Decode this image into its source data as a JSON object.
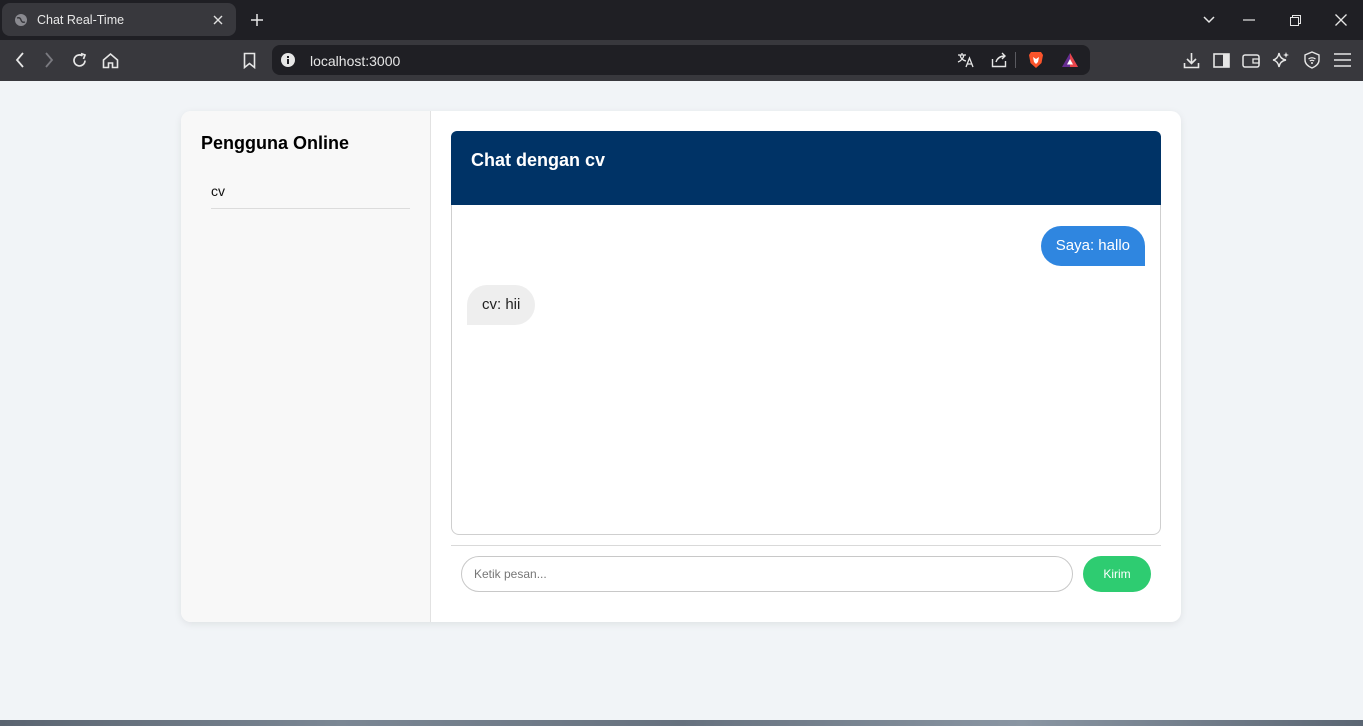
{
  "browser": {
    "tab_title": "Chat Real-Time",
    "url": "localhost:3000"
  },
  "icons": {
    "tab": "globe-icon",
    "tab_close": "close-icon",
    "new_tab": "plus-icon",
    "back": "arrow-left-icon",
    "forward": "arrow-right-icon",
    "reload": "reload-icon",
    "home": "home-icon",
    "bookmark": "bookmark-icon",
    "site_info": "info-icon",
    "translate": "translate-icon",
    "share": "share-icon",
    "brave_shields": "brave-lion-icon",
    "brave_rewards": "triangle-rewards-icon",
    "downloads": "download-icon",
    "sidebar": "sidebar-icon",
    "wallet": "wallet-icon",
    "leo": "sparkle-icon",
    "vpn": "shield-icon",
    "menu": "hamburger-menu-icon"
  },
  "sidebar": {
    "title": "Pengguna Online",
    "users": [
      "cv"
    ]
  },
  "chat": {
    "header": "Chat dengan cv",
    "messages": [
      {
        "from": "me",
        "text": "Saya: hallo"
      },
      {
        "from": "them",
        "text": "cv: hii"
      }
    ],
    "input_placeholder": "Ketik pesan...",
    "input_value": "",
    "send_label": "Kirim"
  },
  "colors": {
    "header_bg": "#003366",
    "my_bubble": "#2f86e0",
    "their_bubble": "#eeeeee",
    "send_button": "#2ecc71",
    "page_bg": "#f1f4f7"
  }
}
